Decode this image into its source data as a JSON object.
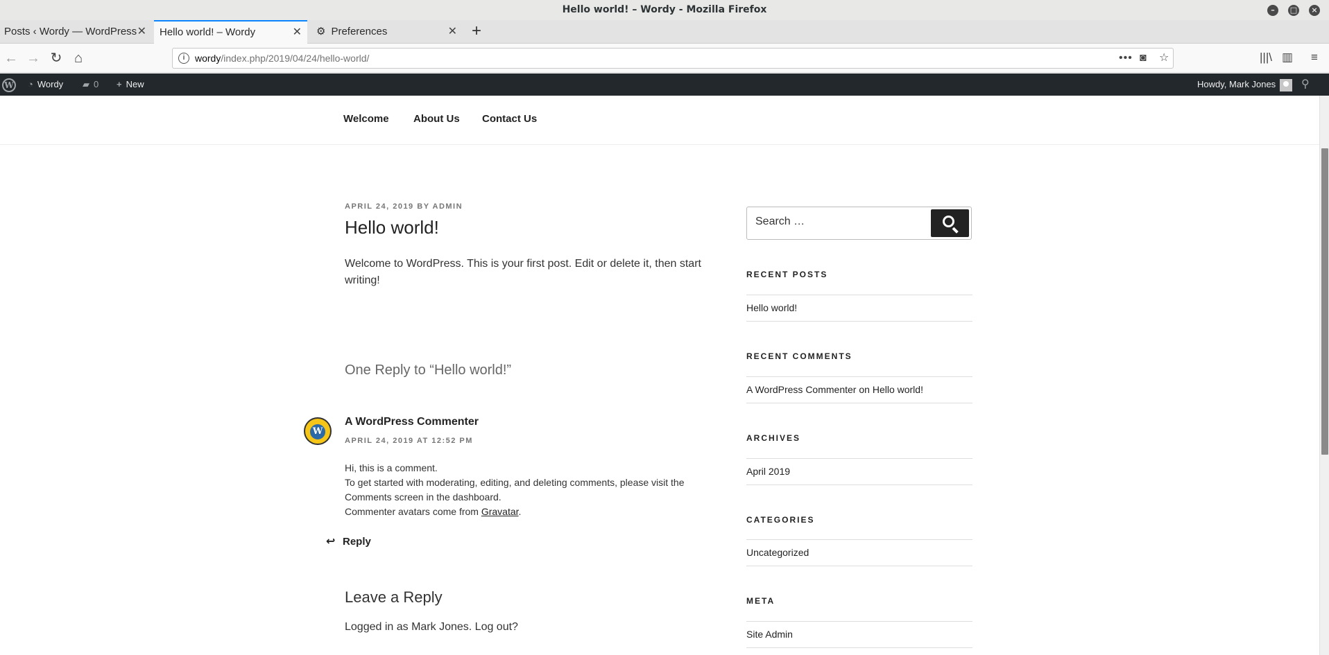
{
  "window": {
    "title": "Hello world! – Wordy - Mozilla Firefox"
  },
  "tabs": [
    {
      "label": "Posts ‹ Wordy — WordPress"
    },
    {
      "label": "Hello world! – Wordy"
    },
    {
      "label": "Preferences"
    }
  ],
  "urlbar": {
    "host": "wordy",
    "path": "/index.php/2019/04/24/hello-world/"
  },
  "adminbar": {
    "site_name": "Wordy",
    "comments_count": "0",
    "new_label": "New",
    "howdy": "Howdy, Mark Jones"
  },
  "sitenav": {
    "items": [
      {
        "label": "Welcome"
      },
      {
        "label": "About Us"
      },
      {
        "label": "Contact Us"
      }
    ]
  },
  "post": {
    "date": "April 24, 2019",
    "by": "by",
    "author": "admin",
    "title": "Hello world!",
    "body": "Welcome to WordPress. This is your first post. Edit or delete it, then start writing!"
  },
  "comments": {
    "heading": "One Reply to “Hello world!”",
    "author": "A WordPress Commenter",
    "date": "April 24, 2019 at 12:52 pm",
    "line1": "Hi, this is a comment.",
    "line2": "To get started with moderating, editing, and deleting comments, please visit the Comments screen in the dashboard.",
    "line3_prefix": "Commenter avatars come from ",
    "line3_link": "Gravatar",
    "line3_suffix": ".",
    "reply_label": "Reply"
  },
  "respond": {
    "heading": "Leave a Reply",
    "logged_in": "Logged in as Mark Jones. Log out?"
  },
  "sidebar": {
    "search_placeholder": "Search …",
    "recent_posts_title": "Recent Posts",
    "recent_posts": [
      "Hello world!"
    ],
    "recent_comments_title": "Recent Comments",
    "recent_comment_author": "A WordPress Commenter",
    "recent_comment_on": "on",
    "recent_comment_post": "Hello world!",
    "archives_title": "Archives",
    "archives": [
      "April 2019"
    ],
    "categories_title": "Categories",
    "categories": [
      "Uncategorized"
    ],
    "meta_title": "Meta",
    "meta": [
      "Site Admin"
    ]
  },
  "colors": {
    "admin_bar": "#23282d",
    "tab_accent": "#0a84ff"
  }
}
